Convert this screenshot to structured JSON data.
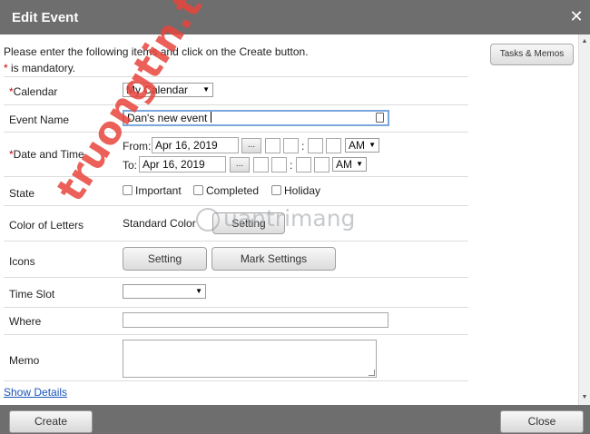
{
  "dialog": {
    "title": "Edit Event",
    "close_icon": "close-icon"
  },
  "intro": {
    "text": "Please enter the following items and click on the Create button.",
    "mandatory_star": "*",
    "mandatory_text": " is mandatory."
  },
  "tasks_button": "Tasks & Memos",
  "fields": {
    "calendar": {
      "star": "*",
      "label": "Calendar",
      "value": "My Calendar"
    },
    "event_name": {
      "label": "Event Name",
      "value": "Dan's new event"
    },
    "date_time": {
      "star": "*",
      "label": "Date and Time",
      "from_label": "From:",
      "from_date": "Apr 16, 2019",
      "from_ampm": "AM",
      "to_label": "To:",
      "to_date": "Apr 16, 2019",
      "to_ampm": "AM",
      "picker_label": "...",
      "colon": ":"
    },
    "state": {
      "label": "State",
      "options": [
        "Important",
        "Completed",
        "Holiday"
      ]
    },
    "color_of_letters": {
      "label": "Color of Letters",
      "value": "Standard Color",
      "button": "Setting"
    },
    "icons": {
      "label": "Icons",
      "setting_button": "Setting",
      "mark_button": "Mark Settings"
    },
    "time_slot": {
      "label": "Time Slot",
      "value": ""
    },
    "where": {
      "label": "Where",
      "value": ""
    },
    "memo": {
      "label": "Memo",
      "value": ""
    }
  },
  "show_details": "Show Details",
  "footer": {
    "create_button": "Create",
    "close_button": "Close"
  },
  "watermarks": {
    "red": "truongtin.top",
    "gray": "uantrimang"
  },
  "colors": {
    "titlebar": "#6e6e6e",
    "mandatory": "#cc0000",
    "link": "#1a55b8",
    "focus_border": "#7aa7dd"
  }
}
